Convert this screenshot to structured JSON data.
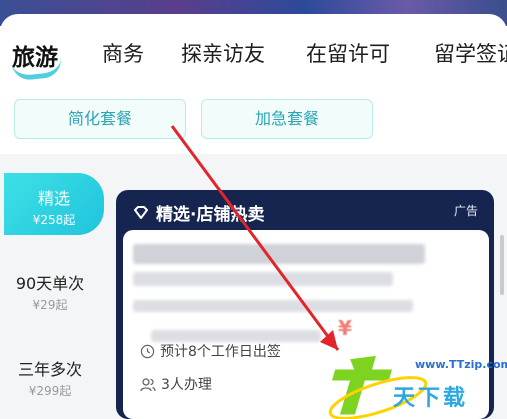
{
  "tabs": [
    {
      "label": "旅游",
      "active": true
    },
    {
      "label": "商务",
      "active": false
    },
    {
      "label": "探亲访友",
      "active": false
    },
    {
      "label": "在留许可",
      "active": false
    },
    {
      "label": "留学签证",
      "active": false
    }
  ],
  "packages": [
    {
      "label": "简化套餐"
    },
    {
      "label": "加急套餐"
    }
  ],
  "sidebar": {
    "items": [
      {
        "name": "精选",
        "price": "¥258起",
        "active": true
      },
      {
        "name": "90天单次",
        "price": "¥29起",
        "active": false
      },
      {
        "name": "三年多次",
        "price": "¥299起",
        "active": false
      }
    ]
  },
  "ad_card": {
    "title": "精选·店铺热卖",
    "tag": "广告",
    "processing_time": "预计8个工作日出签",
    "applicants": "3人办理"
  },
  "watermark": {
    "url": "www.TTzip.com",
    "brand": "天下载"
  },
  "colors": {
    "accent": "#2ec7d8",
    "card_dark": "#15254f",
    "arrow_red": "#e3242b"
  }
}
